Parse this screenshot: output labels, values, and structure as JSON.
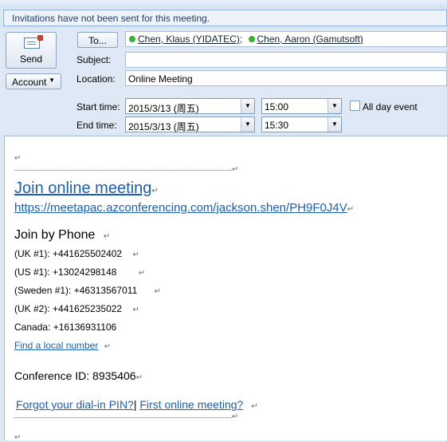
{
  "infobar": {
    "text": "Invitations have not been sent for this meeting."
  },
  "buttons": {
    "send": "Send",
    "account": "Account",
    "to": "To..."
  },
  "labels": {
    "subject": "Subject:",
    "location": "Location:",
    "start_time": "Start time:",
    "end_time": "End time:",
    "all_day": "All day event"
  },
  "recipients": [
    {
      "name": "Chen, Klaus (YIDATEC)",
      "sep": ";"
    },
    {
      "name": "Chen, Aaron (Gamutsoft)",
      "sep": ""
    }
  ],
  "fields": {
    "subject": "",
    "location": "Online Meeting",
    "start_date": "2015/3/13 (周五)",
    "start_time": "15:00",
    "end_date": "2015/3/13 (周五)",
    "end_time": "15:30",
    "all_day_checked": false
  },
  "body": {
    "mark": "↵",
    "join_online": "Join online meeting",
    "meeting_url": "https://meetapac.azconferencing.com/jackson.shen/PH9F0J4V",
    "join_phone": "Join by Phone",
    "phones": [
      "(UK #1): +441625502402",
      "(US #1): +13024298148",
      "(Sweden #1): +46313567011",
      "(UK #2): +441625235022",
      "Canada: +16136931106"
    ],
    "find_local": "Find a local number",
    "conference_id": "Conference ID: 8935406",
    "forgot_pin": "Forgot your dial-in PIN?",
    "pipe": "|",
    "first_meeting": "First online meeting?"
  },
  "colors": {
    "link": "#1a5fb4",
    "presence": "#35b231",
    "infobar_text": "#1f3e6e"
  }
}
